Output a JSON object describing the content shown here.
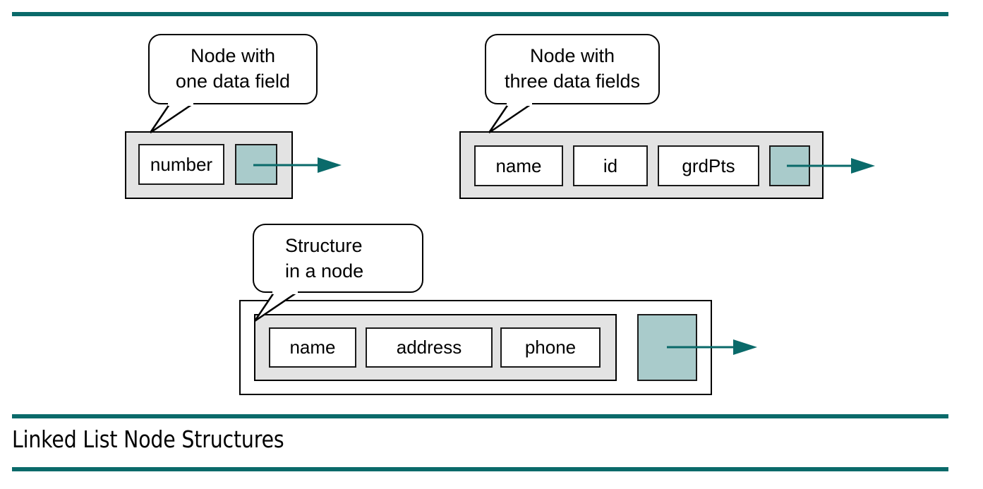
{
  "slide": {
    "title": "Linked List Node Structures",
    "accent_color": "#0a6a6a",
    "node_fill": "#e3e3e3",
    "pointer_fill": "#a9cbcb",
    "field_fill": "#ffffff",
    "outline_color": "#000000"
  },
  "callouts": [
    {
      "id": "node-one-field",
      "line1": "Node with",
      "line2": "one data field",
      "align": "center"
    },
    {
      "id": "node-three-fields",
      "line1": "Node with",
      "line2": "three data fields",
      "align": "center"
    },
    {
      "id": "structure-in-node",
      "line1": "Structure",
      "line2": "in a node",
      "align": "left"
    }
  ],
  "nodes": [
    {
      "id": "node-one-field",
      "fields": [
        "number"
      ],
      "pointer_label": "next-pointer",
      "has_struct_box": false
    },
    {
      "id": "node-three-fields",
      "fields": [
        "name",
        "id",
        "grdPts"
      ],
      "pointer_label": "next-pointer",
      "has_struct_box": false
    },
    {
      "id": "node-with-structure",
      "fields": [
        "name",
        "address",
        "phone"
      ],
      "pointer_label": "next-pointer",
      "has_struct_box": true
    }
  ]
}
